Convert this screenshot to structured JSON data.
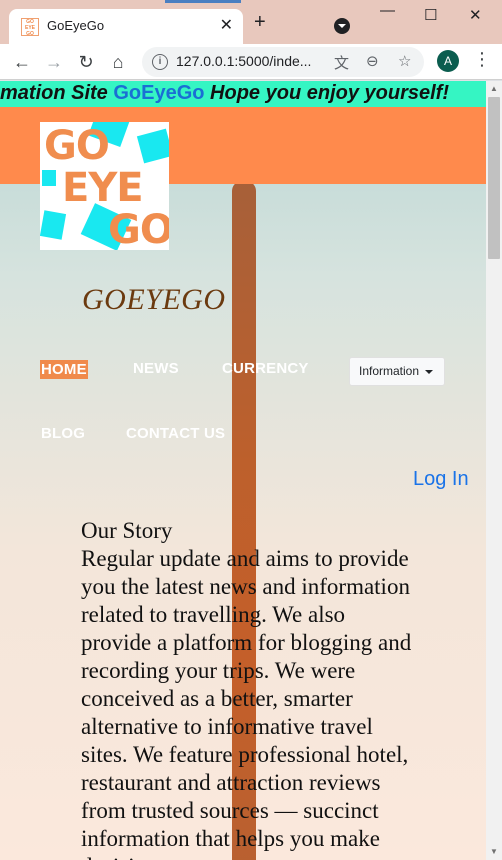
{
  "browser": {
    "tab_title": "GoEyeGo",
    "favicon_text": "GO EYE GO",
    "new_tab": "+",
    "close_tab": "✕",
    "url": "127.0.0.1:5000/inde...",
    "avatar_letter": "A"
  },
  "site": {
    "marquee_prefix": "mation Site ",
    "marquee_brand": "GoEyeGo",
    "marquee_suffix": " Hope you enjoy yourself!",
    "logo_line1": "GO",
    "logo_line2": "EYE",
    "logo_line3": "GO",
    "title": "GOEYEGO",
    "nav": {
      "home": "HOME",
      "news": "NEWS",
      "currency": "CURRENCY",
      "information": "Information",
      "blog": "BLOG",
      "contact": "CONTACT US"
    },
    "login": "Log In",
    "story_heading": "Our Story",
    "story_body": "Regular update and aims to provide you the latest news and information related to travelling. We also provide a platform for blogging and recording your trips. We were conceived as a better, smarter alternative to informative travel sites. We feature professional hotel, restaurant and attraction reviews from trusted sources — succinct information that helps you make decisions"
  },
  "colors": {
    "marquee_bg": "#35f5c3",
    "header_bg": "#ff8a4c",
    "accent": "#f08a4b",
    "link": "#1a73e8"
  }
}
